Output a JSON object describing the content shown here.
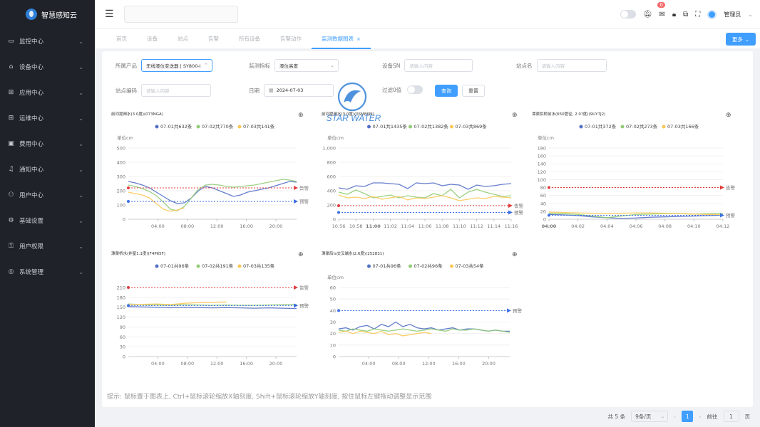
{
  "app": {
    "name": "智慧感知云"
  },
  "sidebar": {
    "items": [
      {
        "label": "监控中心",
        "icon": "monitor-icon"
      },
      {
        "label": "设备中心",
        "icon": "device-icon"
      },
      {
        "label": "应用中心",
        "icon": "apps-icon"
      },
      {
        "label": "运维中心",
        "icon": "ops-icon"
      },
      {
        "label": "费用中心",
        "icon": "billing-icon"
      },
      {
        "label": "通知中心",
        "icon": "bell-icon"
      },
      {
        "label": "用户中心",
        "icon": "user-icon"
      },
      {
        "label": "基础设置",
        "icon": "settings-icon"
      },
      {
        "label": "用户权限",
        "icon": "permission-icon"
      },
      {
        "label": "系统管理",
        "icon": "system-icon"
      }
    ]
  },
  "header": {
    "badge_count": "0",
    "user_name": "管理员"
  },
  "tabs": [
    {
      "label": "首页",
      "active": false
    },
    {
      "label": "设备",
      "active": false
    },
    {
      "label": "站点",
      "active": false
    },
    {
      "label": "告警",
      "active": false
    },
    {
      "label": "所有设备",
      "active": false
    },
    {
      "label": "告警动作",
      "active": false
    },
    {
      "label": "监测数据图表",
      "active": true
    }
  ],
  "more_button": "更多",
  "filters": {
    "product_label": "所属产品",
    "product_value": "无线液位变送器 | SY800-I",
    "metric_label": "监测指标",
    "metric_value": "液位高度",
    "sn_label": "设备SN",
    "sn_placeholder": "请输入内容",
    "site_name_label": "站点名",
    "site_name_placeholder": "请输入内容",
    "site_code_label": "站点编码",
    "site_code_placeholder": "请输入内容",
    "date_label": "日期",
    "date_value": "2024-07-03",
    "filter_zero_label": "过滤0值",
    "query_button": "查询",
    "reset_button": "重置"
  },
  "watermark_text": "STAR WATER",
  "alarm_labels": {
    "alarm": "告警",
    "warning": "预警"
  },
  "colors": {
    "s1": "#5470c6",
    "s2": "#91cc75",
    "s3": "#fac858",
    "alarm": "#e03c3c",
    "warning": "#3b6fe6",
    "primary": "#409eff"
  },
  "charts": [
    {
      "title": "前河提闸水(3.0度)(073NGA)",
      "unit": "单位cm",
      "legend": [
        "07-01共632条",
        "07-02共770条",
        "07-03共141条"
      ],
      "chart_data": {
        "type": "line",
        "y_ticks": [
          "500",
          "400",
          "300",
          "200",
          "100",
          "0"
        ],
        "ylim": [
          0,
          500
        ],
        "x_ticks": [
          "04:00",
          "08:00",
          "12:00",
          "16:00",
          "20:00"
        ],
        "xlim": [
          0,
          24
        ],
        "alarm_value": 220,
        "warning_value": 125,
        "series": [
          {
            "name": "07-01共632条",
            "x": [
              0,
              1,
              2,
              3,
              4,
              5,
              6,
              7,
              8,
              9,
              10,
              11,
              12,
              13,
              14,
              15,
              16,
              17,
              18,
              19,
              20,
              21,
              22,
              23,
              24
            ],
            "values": [
              265,
              255,
              240,
              220,
              190,
              160,
              130,
              110,
              115,
              150,
              200,
              230,
              220,
              200,
              180,
              160,
              170,
              190,
              200,
              210,
              220,
              235,
              250,
              265,
              260
            ]
          },
          {
            "name": "07-02共770条",
            "x": [
              0,
              1,
              2,
              3,
              4,
              5,
              6,
              7,
              8,
              9,
              10,
              11,
              12,
              13,
              14,
              15,
              16,
              17,
              18,
              19,
              20,
              21,
              22,
              23,
              24
            ],
            "values": [
              240,
              230,
              215,
              195,
              165,
              120,
              70,
              60,
              90,
              150,
              210,
              240,
              245,
              240,
              230,
              225,
              230,
              235,
              240,
              250,
              260,
              270,
              280,
              275,
              265
            ]
          },
          {
            "name": "07-03共141条",
            "x": [
              0,
              1,
              2,
              3,
              4,
              5,
              6,
              7,
              8
            ],
            "values": [
              190,
              180,
              170,
              150,
              110,
              70,
              55,
              65,
              80
            ]
          }
        ]
      }
    },
    {
      "title": "前河提闸水(3.0度)(0SM86M)",
      "unit": "单位cm",
      "legend": [
        "07-01共1435条",
        "07-02共1382条",
        "07-03共869条"
      ],
      "chart_data": {
        "type": "line",
        "y_ticks": [
          "1,000",
          "800",
          "600",
          "400",
          "200",
          "0"
        ],
        "ylim": [
          0,
          1000
        ],
        "x_ticks": [
          "10:56",
          "10:58",
          "11:00",
          "11:02",
          "11:04",
          "11:06",
          "11:08",
          "11:10",
          "11:12",
          "11:14",
          "11:16"
        ],
        "xlim": [
          0,
          20
        ],
        "alarm_value": 190,
        "warning_value": 95,
        "series": [
          {
            "name": "07-01共1435条",
            "x": [
              0,
              1,
              2,
              3,
              4,
              5,
              6,
              7,
              8,
              9,
              10,
              11,
              12,
              13,
              14,
              15,
              16,
              17,
              18,
              19,
              20
            ],
            "values": [
              440,
              420,
              470,
              460,
              510,
              510,
              500,
              490,
              430,
              510,
              500,
              510,
              470,
              490,
              480,
              420,
              480,
              460,
              470,
              490,
              500
            ]
          },
          {
            "name": "07-02共1382条",
            "x": [
              0,
              1,
              2,
              3,
              4,
              5,
              6,
              7,
              8,
              9,
              10,
              11,
              12,
              13,
              14,
              15,
              16,
              17,
              18,
              19,
              20
            ],
            "values": [
              380,
              350,
              410,
              360,
              300,
              320,
              340,
              300,
              330,
              310,
              300,
              360,
              330,
              420,
              300,
              380,
              420,
              380,
              350,
              320,
              330
            ]
          },
          {
            "name": "07-03共869条",
            "x": [
              0,
              1,
              2,
              3,
              4,
              5,
              6,
              7,
              8,
              9,
              10,
              11,
              12,
              13,
              14,
              15,
              16,
              17,
              18,
              19,
              20
            ],
            "values": [
              340,
              300,
              310,
              290,
              320,
              280,
              300,
              320,
              270,
              300,
              290,
              310,
              330,
              300,
              260,
              280,
              300,
              290,
              320,
              310,
              300
            ]
          }
        ]
      }
    },
    {
      "title": "潭渠拱桥前水(650管径, 2.0?度)(9UY7J2)",
      "unit": "单位cm",
      "legend": [
        "07-01共372条",
        "07-02共273条",
        "07-03共166条"
      ],
      "chart_data": {
        "type": "line",
        "y_ticks": [
          "180",
          "160",
          "140",
          "120",
          "100",
          "80",
          "60",
          "40",
          "20",
          "0"
        ],
        "ylim": [
          0,
          180
        ],
        "x_ticks": [
          "04:00",
          "04:02",
          "04:04",
          "04:06",
          "04:08",
          "04:10",
          "04:12"
        ],
        "xlim": [
          0,
          12
        ],
        "alarm_value": 80,
        "warning_value": 10,
        "series": [
          {
            "name": "07-01共372条",
            "x": [
              0,
              1,
              2,
              3,
              4,
              5,
              6,
              7,
              8,
              9,
              10,
              11,
              12
            ],
            "values": [
              12,
              11,
              9,
              6,
              4,
              2,
              3,
              5,
              6,
              7,
              8,
              9,
              10
            ]
          },
          {
            "name": "07-02共273条",
            "x": [
              0,
              1,
              2,
              3,
              4,
              5,
              6,
              7,
              8,
              9,
              10,
              11,
              12
            ],
            "values": [
              15,
              14,
              12,
              8,
              4,
              8,
              12,
              13,
              14,
              14,
              13,
              14,
              15
            ]
          },
          {
            "name": "07-03共166条",
            "x": [
              0,
              1,
              2,
              3,
              4,
              5,
              6,
              7,
              8,
              9,
              10,
              11,
              12
            ],
            "values": [
              18,
              17,
              16,
              15,
              14,
              15,
              16,
              16,
              15,
              14,
              13,
              12,
              11
            ]
          }
        ]
      }
    },
    {
      "title": "潭渠桥水(井屋1.1度)(F4P65F)",
      "unit": "",
      "legend": [
        "07-01共96条",
        "07-02共191条",
        "07-03共135条"
      ],
      "chart_data": {
        "type": "line",
        "y_ticks": [
          "210",
          "180",
          "150",
          "120",
          "90",
          "60",
          "30",
          "0"
        ],
        "ylim": [
          0,
          210
        ],
        "x_ticks": [
          "04:00",
          "08:00",
          "12:00",
          "16:00",
          "20:00"
        ],
        "xlim": [
          0,
          24
        ],
        "alarm_value": 210,
        "warning_value": 155,
        "series": [
          {
            "name": "07-01共96条",
            "x": [
              0,
              2,
              4,
              6,
              8,
              10,
              12,
              14,
              16,
              18,
              20,
              22,
              24
            ],
            "values": [
              152,
              151,
              150,
              149,
              150,
              149,
              148,
              149,
              148,
              147,
              148,
              147,
              146
            ]
          },
          {
            "name": "07-02共191条",
            "x": [
              0,
              2,
              4,
              6,
              8,
              10,
              12,
              14,
              16,
              18,
              20,
              22,
              24
            ],
            "values": [
              160,
              158,
              157,
              156,
              158,
              157,
              156,
              157,
              156,
              156,
              157,
              158,
              159
            ]
          },
          {
            "name": "07-03共135条",
            "x": [
              0,
              2,
              4,
              6,
              8,
              10,
              12,
              14
            ],
            "values": [
              158,
              159,
              160,
              158,
              162,
              164,
              165,
              166
            ]
          }
        ]
      }
    },
    {
      "title": "潭渠后ts交叉端水(2.6度)(252831)",
      "unit": "单位cm",
      "legend": [
        "07-01共96条",
        "07-02共96条",
        "07-03共54条"
      ],
      "chart_data": {
        "type": "line",
        "y_ticks": [
          "60",
          "50",
          "40",
          "30",
          "20",
          "10",
          "0"
        ],
        "ylim": [
          0,
          60
        ],
        "x_ticks": [
          "04:00",
          "08:00",
          "12:00",
          "16:00",
          "20:00"
        ],
        "xlim": [
          0,
          24
        ],
        "alarm_value": null,
        "warning_value": 40,
        "series": [
          {
            "name": "07-01共96条",
            "x": [
              0,
              1,
              2,
              3,
              4,
              5,
              6,
              7,
              8,
              9,
              10,
              11,
              12,
              13,
              14,
              15,
              16,
              17,
              18,
              19,
              20,
              21,
              22,
              23,
              24
            ],
            "values": [
              24,
              25,
              23,
              26,
              27,
              24,
              28,
              26,
              30,
              26,
              28,
              25,
              24,
              25,
              23,
              24,
              25,
              23,
              24,
              24,
              23,
              22,
              23,
              22,
              22
            ]
          },
          {
            "name": "07-02共96条",
            "x": [
              0,
              1,
              2,
              3,
              4,
              5,
              6,
              7,
              8,
              9,
              10,
              11,
              12,
              13,
              14,
              15,
              16,
              17,
              18,
              19,
              20,
              21,
              22,
              23,
              24
            ],
            "values": [
              23,
              22,
              24,
              23,
              22,
              24,
              23,
              22,
              23,
              24,
              23,
              22,
              23,
              24,
              23,
              22,
              24,
              23,
              23,
              24,
              23,
              22,
              23,
              22,
              21
            ]
          },
          {
            "name": "07-03共54条",
            "x": [
              0,
              1,
              2,
              3,
              4,
              5,
              6,
              7,
              8,
              9,
              10,
              11,
              12,
              13
            ],
            "values": [
              21,
              22,
              20,
              22,
              21,
              20,
              22,
              19,
              20,
              18,
              19,
              20,
              21,
              20
            ]
          }
        ]
      }
    }
  ],
  "hint": "提示: 鼠标置于图表上, Ctrl+鼠标滚轮缩放X轴刻度, Shift+鼠标滚轮缩放Y轴刻度, 按住鼠标左键拖动调整显示范围",
  "pager": {
    "total": "共 5 条",
    "page_size": "9条/页",
    "current": "1",
    "goto_label": "前往",
    "goto_value": "1",
    "page_unit": "页"
  }
}
